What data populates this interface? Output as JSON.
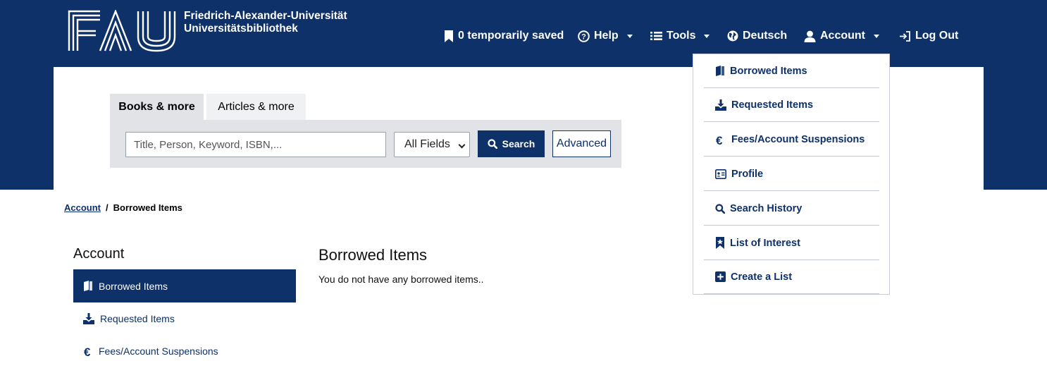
{
  "brand": {
    "logo_text": "FAU",
    "line1": "Friedrich-Alexander-Universität",
    "line2": "Universitätsbibliothek"
  },
  "topnav": {
    "saved_count": "0",
    "saved_label": "temporarily saved",
    "help": "Help",
    "tools": "Tools",
    "language": "Deutsch",
    "account": "Account",
    "logout": "Log Out"
  },
  "search": {
    "tabs": [
      "Books & more",
      "Articles & more"
    ],
    "placeholder": "Title, Person, Keyword, ISBN,...",
    "field_select": "All Fields",
    "search_button": "Search",
    "advanced_button": "Advanced"
  },
  "breadcrumb": {
    "parent": "Account",
    "separator": "/",
    "current": "Borrowed Items"
  },
  "sidebar": {
    "title": "Account",
    "items": [
      {
        "label": "Borrowed Items",
        "icon": "book-icon",
        "active": true
      },
      {
        "label": "Requested Items",
        "icon": "download-tray-icon"
      },
      {
        "label": "Fees/Account Suspensions",
        "icon": "euro-icon"
      }
    ]
  },
  "main": {
    "title": "Borrowed Items",
    "message": "You do not have any borrowed items.."
  },
  "account_menu": {
    "items": [
      {
        "label": "Borrowed Items",
        "icon": "book-icon"
      },
      {
        "label": "Requested Items",
        "icon": "download-tray-icon"
      },
      {
        "label": "Fees/Account Suspensions",
        "icon": "euro-icon"
      },
      {
        "label": "Profile",
        "icon": "id-card-icon"
      },
      {
        "label": "Search History",
        "icon": "search-icon"
      },
      {
        "label": "List of Interest",
        "icon": "bookmark-icon"
      },
      {
        "label": "Create a List",
        "icon": "plus-square-icon"
      }
    ]
  },
  "colors": {
    "brand_blue": "#0d3168",
    "search_panel": "#e1e3e7",
    "white": "#ffffff"
  }
}
